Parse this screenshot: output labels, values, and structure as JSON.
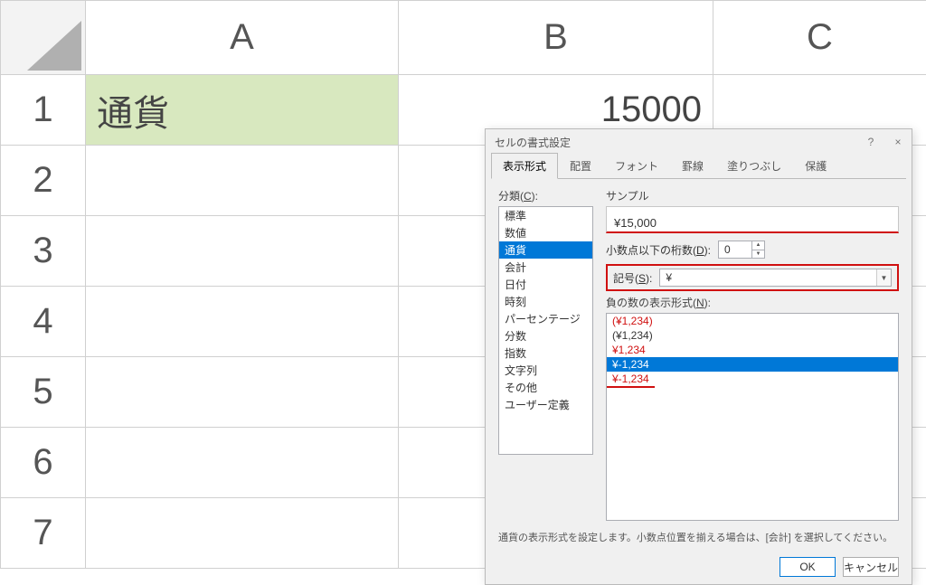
{
  "sheet": {
    "cols": [
      "A",
      "B",
      "C"
    ],
    "rows": [
      "1",
      "2",
      "3",
      "4",
      "5",
      "6",
      "7"
    ],
    "cells": {
      "a1": "通貨",
      "b1": "15000"
    }
  },
  "dialog": {
    "title": "セルの書式設定",
    "help_char": "?",
    "close_char": "×",
    "tabs": [
      "表示形式",
      "配置",
      "フォント",
      "罫線",
      "塗りつぶし",
      "保護"
    ],
    "active_tab": 0,
    "category_label": "分類(C):",
    "categories": [
      "標準",
      "数値",
      "通貨",
      "会計",
      "日付",
      "時刻",
      "パーセンテージ",
      "分数",
      "指数",
      "文字列",
      "その他",
      "ユーザー定義"
    ],
    "category_selected": 2,
    "sample_label": "サンプル",
    "sample_value": "¥15,000",
    "decimals_label": "小数点以下の桁数(D):",
    "decimals_value": "0",
    "symbol_label": "記号(S):",
    "symbol_value": "¥",
    "negative_label": "負の数の表示形式(N):",
    "negative_items": [
      {
        "text": "(¥1,234)",
        "cls": "red"
      },
      {
        "text": "(¥1,234)",
        "cls": ""
      },
      {
        "text": "¥1,234",
        "cls": "red"
      },
      {
        "text": "¥-1,234",
        "cls": "selected"
      },
      {
        "text": "¥-1,234",
        "cls": "sel-red"
      }
    ],
    "hint": "通貨の表示形式を設定します。小数点位置を揃える場合は、[会計] を選択してください。",
    "ok": "OK",
    "cancel": "キャンセル"
  }
}
